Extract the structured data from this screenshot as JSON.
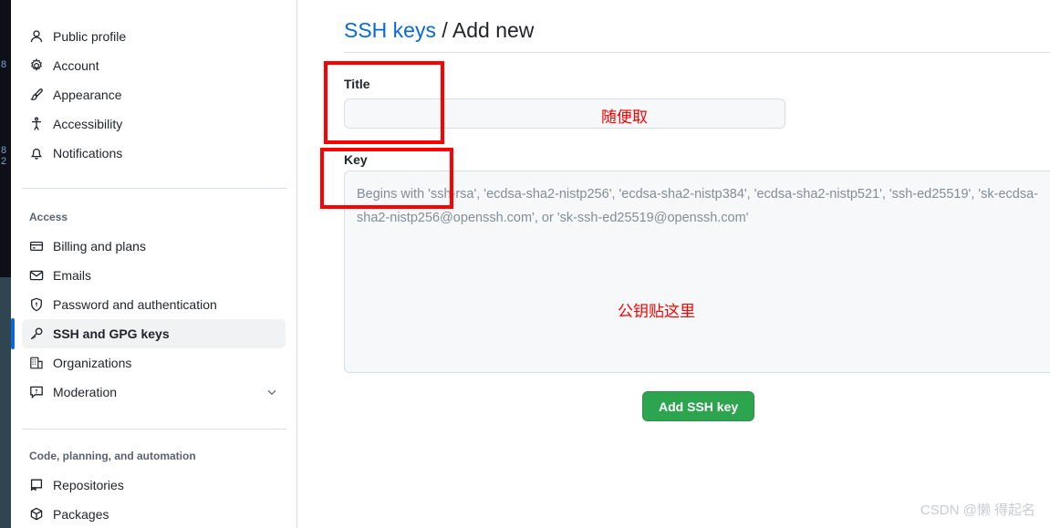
{
  "left_strip": {
    "glyphs": [
      "8",
      "8",
      "2"
    ],
    "color": "#0d1117"
  },
  "sidebar": {
    "groups": [
      {
        "heading": "",
        "items": [
          {
            "label": "Public profile",
            "icon": "person-icon",
            "selected": false,
            "chevron": false
          },
          {
            "label": "Account",
            "icon": "gear-icon",
            "selected": false,
            "chevron": false
          },
          {
            "label": "Appearance",
            "icon": "paintbrush-icon",
            "selected": false,
            "chevron": false
          },
          {
            "label": "Accessibility",
            "icon": "accessibility-icon",
            "selected": false,
            "chevron": false
          },
          {
            "label": "Notifications",
            "icon": "bell-icon",
            "selected": false,
            "chevron": false
          }
        ]
      },
      {
        "heading": "Access",
        "items": [
          {
            "label": "Billing and plans",
            "icon": "credit-card-icon",
            "selected": false,
            "chevron": false
          },
          {
            "label": "Emails",
            "icon": "mail-icon",
            "selected": false,
            "chevron": false
          },
          {
            "label": "Password and authentication",
            "icon": "shield-lock-icon",
            "selected": false,
            "chevron": false
          },
          {
            "label": "SSH and GPG keys",
            "icon": "key-icon",
            "selected": true,
            "chevron": false
          },
          {
            "label": "Organizations",
            "icon": "organization-icon",
            "selected": false,
            "chevron": false
          },
          {
            "label": "Moderation",
            "icon": "report-icon",
            "selected": false,
            "chevron": true
          }
        ]
      },
      {
        "heading": "Code, planning, and automation",
        "items": [
          {
            "label": "Repositories",
            "icon": "repo-icon",
            "selected": false,
            "chevron": false
          },
          {
            "label": "Packages",
            "icon": "package-icon",
            "selected": false,
            "chevron": false
          }
        ]
      }
    ],
    "selected_accent_color": "#0969da",
    "selected_background": "#f1f2f4"
  },
  "main": {
    "title": {
      "link_text": "SSH keys",
      "separator": " / ",
      "current": "Add new"
    },
    "title_field": {
      "label": "Title",
      "value": "",
      "placeholder": ""
    },
    "key_field": {
      "label": "Key",
      "value": "",
      "placeholder_line1": "Begins with 'ssh-rsa', 'ecdsa-sha2-nistp256', 'ecdsa-sha2-nistp384', 'ecdsa-sha2-nistp521', 'ssh-ed25519', 'sk-ecdsa-",
      "placeholder_line2": "sha2-nistp256@openssh.com', or 'sk-ssh-ed25519@openssh.com'"
    },
    "submit_button": {
      "label": "Add SSH key",
      "color": "#2da44e"
    }
  },
  "annotations": {
    "color": "#ff0000",
    "title_note": "随便取",
    "key_note": "公钥贴这里"
  },
  "watermark": {
    "text": "CSDN @懒 得起名"
  }
}
